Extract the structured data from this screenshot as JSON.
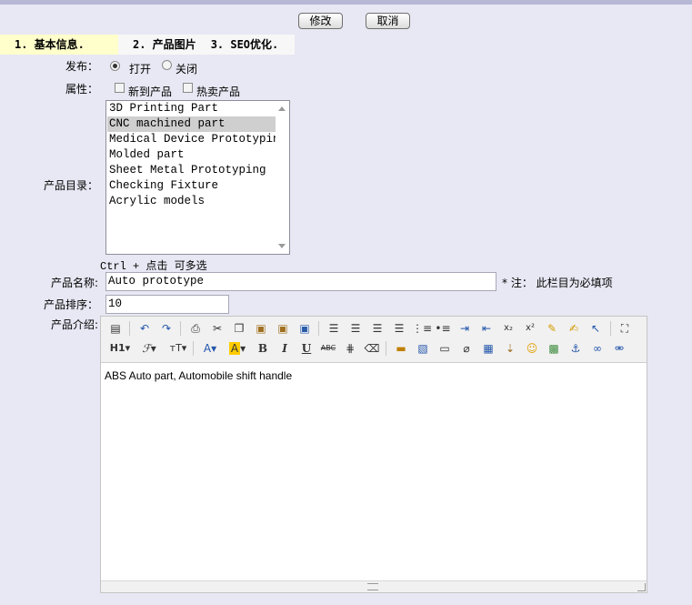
{
  "header": {
    "edit_label": "修改",
    "cancel_label": "取消"
  },
  "tabs": [
    "1. 基本信息.",
    "2. 产品图片",
    "3. SEO优化."
  ],
  "form": {
    "publish_label": "发布：",
    "publish_options": [
      {
        "label": "打开",
        "checked": true
      },
      {
        "label": "关闭",
        "checked": false
      }
    ],
    "attr_label": "属性：",
    "attr_options": [
      {
        "label": "新到产品",
        "checked": false
      },
      {
        "label": "热卖产品",
        "checked": false
      }
    ],
    "category_label": "产品目录：",
    "categories": [
      "3D Printing Part",
      "CNC machined part",
      "Medical Device Prototyping",
      "Molded part",
      "Sheet Metal Prototyping",
      "Checking Fixture",
      "Acrylic models"
    ],
    "selected_category": "CNC machined part",
    "multi_hint": "Ctrl + 点击 可多选",
    "name_label": "产品名称:",
    "name_value": "Auto prototype",
    "required_note": "* 注： 此栏目为必填项",
    "sort_label": "产品排序：",
    "sort_value": "10",
    "intro_label": "产品介绍:",
    "intro_content": "ABS Auto part, Automobile shift handle"
  },
  "editor_toolbar": {
    "row1": [
      "source-icon",
      "undo-icon",
      "redo-icon",
      "preview-icon",
      "cut-icon",
      "copy-icon",
      "paste-icon",
      "paste-text-icon",
      "paste-word-icon",
      "align-left-icon",
      "align-center-icon",
      "align-right-icon",
      "align-justify-icon",
      "ordered-list-icon",
      "unordered-list-icon",
      "indent-icon",
      "outdent-icon",
      "subscript-icon",
      "superscript-icon",
      "clear-format-icon",
      "select-all-icon",
      "select-icon",
      "fullscreen-icon"
    ],
    "row2": [
      "heading-icon",
      "font-family-icon",
      "font-size-icon",
      "font-color-icon",
      "highlight-icon",
      "bold-icon",
      "italic-icon",
      "underline-icon",
      "strikethrough-icon",
      "line-height-icon",
      "eraser-icon",
      "image-icon",
      "flash-icon",
      "media-icon",
      "attachment-icon",
      "table-icon",
      "hr-icon",
      "emoticon-icon",
      "map-icon",
      "anchor-icon",
      "link-icon",
      "unlink-icon"
    ]
  }
}
